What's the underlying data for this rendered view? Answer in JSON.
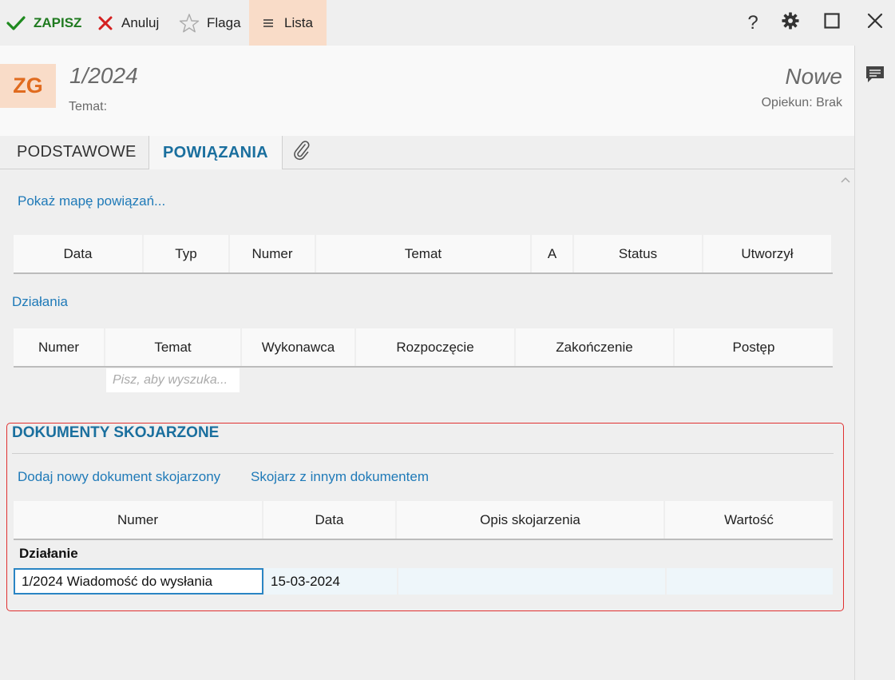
{
  "toolbar": {
    "save_label": "ZAPISZ",
    "cancel_label": "Anuluj",
    "flag_label": "Flaga",
    "list_label": "Lista",
    "help_label": "?"
  },
  "header": {
    "badge": "ZG",
    "number": "1/2024",
    "subject_label": "Temat:",
    "status": "Nowe",
    "guardian": "Opiekun: Brak"
  },
  "tabs": {
    "basic": "PODSTAWOWE",
    "links": "POWIĄZANIA"
  },
  "links_section": {
    "show_map": "Pokaż mapę powiązań...",
    "columns": [
      "Data",
      "Typ",
      "Numer",
      "Temat",
      "A",
      "Status",
      "Utworzył"
    ]
  },
  "actions_section": {
    "title": "Działania",
    "columns": [
      "Numer",
      "Temat",
      "Wykonawca",
      "Rozpoczęcie",
      "Zakończenie",
      "Postęp"
    ],
    "search_placeholder": "Pisz, aby wyszuka..."
  },
  "related_docs": {
    "title": "DOKUMENTY SKOJARZONE",
    "add_new": "Dodaj nowy dokument skojarzony",
    "associate": "Skojarz z innym dokumentem",
    "columns": [
      "Numer",
      "Data",
      "Opis skojarzenia",
      "Wartość"
    ],
    "group": "Działanie",
    "rows": [
      {
        "number": "1/2024 Wiadomość do wysłania",
        "date": "15-03-2024",
        "description": "",
        "value": ""
      }
    ]
  }
}
